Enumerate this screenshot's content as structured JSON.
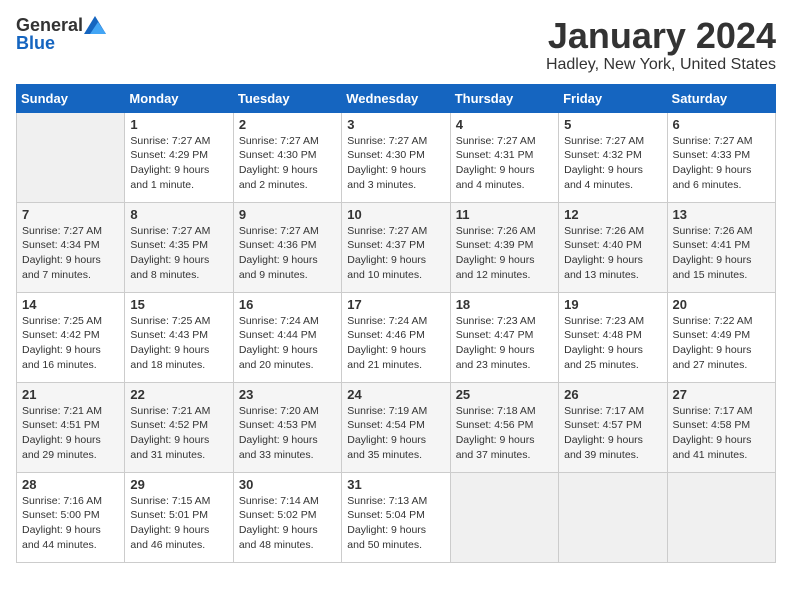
{
  "logo": {
    "general": "General",
    "blue": "Blue"
  },
  "calendar": {
    "title": "January 2024",
    "subtitle": "Hadley, New York, United States"
  },
  "days_of_week": [
    "Sunday",
    "Monday",
    "Tuesday",
    "Wednesday",
    "Thursday",
    "Friday",
    "Saturday"
  ],
  "weeks": [
    [
      {
        "day": "",
        "content": ""
      },
      {
        "day": "1",
        "content": "Sunrise: 7:27 AM\nSunset: 4:29 PM\nDaylight: 9 hours\nand 1 minute."
      },
      {
        "day": "2",
        "content": "Sunrise: 7:27 AM\nSunset: 4:30 PM\nDaylight: 9 hours\nand 2 minutes."
      },
      {
        "day": "3",
        "content": "Sunrise: 7:27 AM\nSunset: 4:30 PM\nDaylight: 9 hours\nand 3 minutes."
      },
      {
        "day": "4",
        "content": "Sunrise: 7:27 AM\nSunset: 4:31 PM\nDaylight: 9 hours\nand 4 minutes."
      },
      {
        "day": "5",
        "content": "Sunrise: 7:27 AM\nSunset: 4:32 PM\nDaylight: 9 hours\nand 4 minutes."
      },
      {
        "day": "6",
        "content": "Sunrise: 7:27 AM\nSunset: 4:33 PM\nDaylight: 9 hours\nand 6 minutes."
      }
    ],
    [
      {
        "day": "7",
        "content": "Sunrise: 7:27 AM\nSunset: 4:34 PM\nDaylight: 9 hours\nand 7 minutes."
      },
      {
        "day": "8",
        "content": "Sunrise: 7:27 AM\nSunset: 4:35 PM\nDaylight: 9 hours\nand 8 minutes."
      },
      {
        "day": "9",
        "content": "Sunrise: 7:27 AM\nSunset: 4:36 PM\nDaylight: 9 hours\nand 9 minutes."
      },
      {
        "day": "10",
        "content": "Sunrise: 7:27 AM\nSunset: 4:37 PM\nDaylight: 9 hours\nand 10 minutes."
      },
      {
        "day": "11",
        "content": "Sunrise: 7:26 AM\nSunset: 4:39 PM\nDaylight: 9 hours\nand 12 minutes."
      },
      {
        "day": "12",
        "content": "Sunrise: 7:26 AM\nSunset: 4:40 PM\nDaylight: 9 hours\nand 13 minutes."
      },
      {
        "day": "13",
        "content": "Sunrise: 7:26 AM\nSunset: 4:41 PM\nDaylight: 9 hours\nand 15 minutes."
      }
    ],
    [
      {
        "day": "14",
        "content": "Sunrise: 7:25 AM\nSunset: 4:42 PM\nDaylight: 9 hours\nand 16 minutes."
      },
      {
        "day": "15",
        "content": "Sunrise: 7:25 AM\nSunset: 4:43 PM\nDaylight: 9 hours\nand 18 minutes."
      },
      {
        "day": "16",
        "content": "Sunrise: 7:24 AM\nSunset: 4:44 PM\nDaylight: 9 hours\nand 20 minutes."
      },
      {
        "day": "17",
        "content": "Sunrise: 7:24 AM\nSunset: 4:46 PM\nDaylight: 9 hours\nand 21 minutes."
      },
      {
        "day": "18",
        "content": "Sunrise: 7:23 AM\nSunset: 4:47 PM\nDaylight: 9 hours\nand 23 minutes."
      },
      {
        "day": "19",
        "content": "Sunrise: 7:23 AM\nSunset: 4:48 PM\nDaylight: 9 hours\nand 25 minutes."
      },
      {
        "day": "20",
        "content": "Sunrise: 7:22 AM\nSunset: 4:49 PM\nDaylight: 9 hours\nand 27 minutes."
      }
    ],
    [
      {
        "day": "21",
        "content": "Sunrise: 7:21 AM\nSunset: 4:51 PM\nDaylight: 9 hours\nand 29 minutes."
      },
      {
        "day": "22",
        "content": "Sunrise: 7:21 AM\nSunset: 4:52 PM\nDaylight: 9 hours\nand 31 minutes."
      },
      {
        "day": "23",
        "content": "Sunrise: 7:20 AM\nSunset: 4:53 PM\nDaylight: 9 hours\nand 33 minutes."
      },
      {
        "day": "24",
        "content": "Sunrise: 7:19 AM\nSunset: 4:54 PM\nDaylight: 9 hours\nand 35 minutes."
      },
      {
        "day": "25",
        "content": "Sunrise: 7:18 AM\nSunset: 4:56 PM\nDaylight: 9 hours\nand 37 minutes."
      },
      {
        "day": "26",
        "content": "Sunrise: 7:17 AM\nSunset: 4:57 PM\nDaylight: 9 hours\nand 39 minutes."
      },
      {
        "day": "27",
        "content": "Sunrise: 7:17 AM\nSunset: 4:58 PM\nDaylight: 9 hours\nand 41 minutes."
      }
    ],
    [
      {
        "day": "28",
        "content": "Sunrise: 7:16 AM\nSunset: 5:00 PM\nDaylight: 9 hours\nand 44 minutes."
      },
      {
        "day": "29",
        "content": "Sunrise: 7:15 AM\nSunset: 5:01 PM\nDaylight: 9 hours\nand 46 minutes."
      },
      {
        "day": "30",
        "content": "Sunrise: 7:14 AM\nSunset: 5:02 PM\nDaylight: 9 hours\nand 48 minutes."
      },
      {
        "day": "31",
        "content": "Sunrise: 7:13 AM\nSunset: 5:04 PM\nDaylight: 9 hours\nand 50 minutes."
      },
      {
        "day": "",
        "content": ""
      },
      {
        "day": "",
        "content": ""
      },
      {
        "day": "",
        "content": ""
      }
    ]
  ]
}
